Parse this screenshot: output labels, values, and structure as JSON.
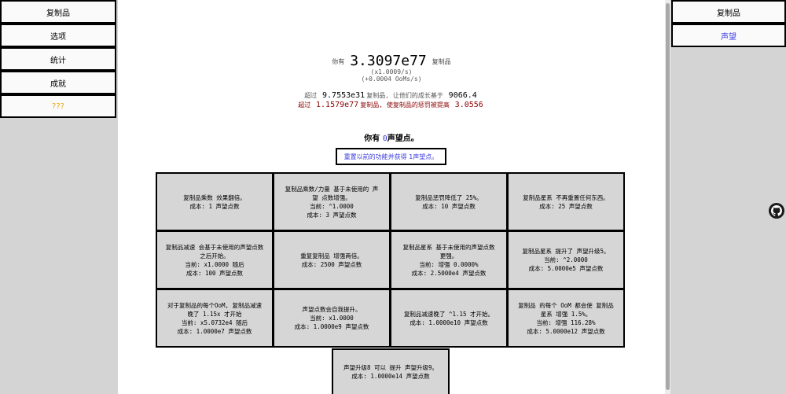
{
  "left_nav": [
    "复制品",
    "选项",
    "统计",
    "成就",
    "???"
  ],
  "right_nav": [
    "复制品",
    "声望"
  ],
  "stats": {
    "you_have_prefix": "你有",
    "amount": "3.3097e77",
    "amount_suffix": "复制品",
    "rate_mult": "(x1.0009/s)",
    "rate_ooms": "(+0.0004 OoMs/s)",
    "beyond_prefix": "超过",
    "beyond_value": "9.7553e31",
    "beyond_mid": "复制品, 让他们的成长基于",
    "beyond_base": "9066.4",
    "penalty_prefix": "超过",
    "penalty_value": "1.1579e77",
    "penalty_mid": "复制品, 使复制品的惩罚被提高",
    "penalty_mult": "3.0556"
  },
  "prestige": {
    "prefix": "你有",
    "points": "0",
    "suffix": "声望点。",
    "reset_label": "重置以前的功能并获得 1声望点。"
  },
  "upgrades": [
    {
      "text": "复制品乘数 效果翻倍。\n成本: 1 声望点数"
    },
    {
      "text": "复制品乘数/力量 基于未使用的 声望 点数增强。\n当前: ^1.0000\n成本: 3 声望点数"
    },
    {
      "text": "复制品惩罚降低了 25%。\n成本: 10 声望点数"
    },
    {
      "text": "复制品星系 不再重置任何东西。\n成本: 25 声望点数"
    },
    {
      "text": "复制品减速 会基于未使用的声望点数 之后开始。\n当前: x1.0000 随后\n成本: 100 声望点数"
    },
    {
      "text": "重复复制品 增强两倍。\n成本: 2500 声望点数"
    },
    {
      "text": "复制品星系 基于未使用的声望点数 更强。\n当前: 增强 0.0000%\n成本: 2.5000e4 声望点数"
    },
    {
      "text": "复制品星系 提升了 声望升级5。\n当前: ^2.0000\n成本: 5.0000e5 声望点数"
    },
    {
      "text": "对于复制品的每个OoM, 复制品减速 晚了 1.15x 才开始\n当前: x5.0732e4 随后\n成本: 1.0000e7 声望点数"
    },
    {
      "text": "声望点数会自我提升。\n当前: x1.0000\n成本: 1.0000e9 声望点数"
    },
    {
      "text": "复制品减速晚了 ^1.15 才开始。\n成本: 1.0000e10 声望点数"
    },
    {
      "text": "复制品 的每个 OoM 都会使 复制品 星系 增强 1.5%。\n当前: 增强 116.28%\n成本: 5.0000e12 声望点数"
    },
    {
      "text": "声望升级8 可以 提升 声望升级9。\n成本: 1.0000e14 声望点数"
    }
  ]
}
